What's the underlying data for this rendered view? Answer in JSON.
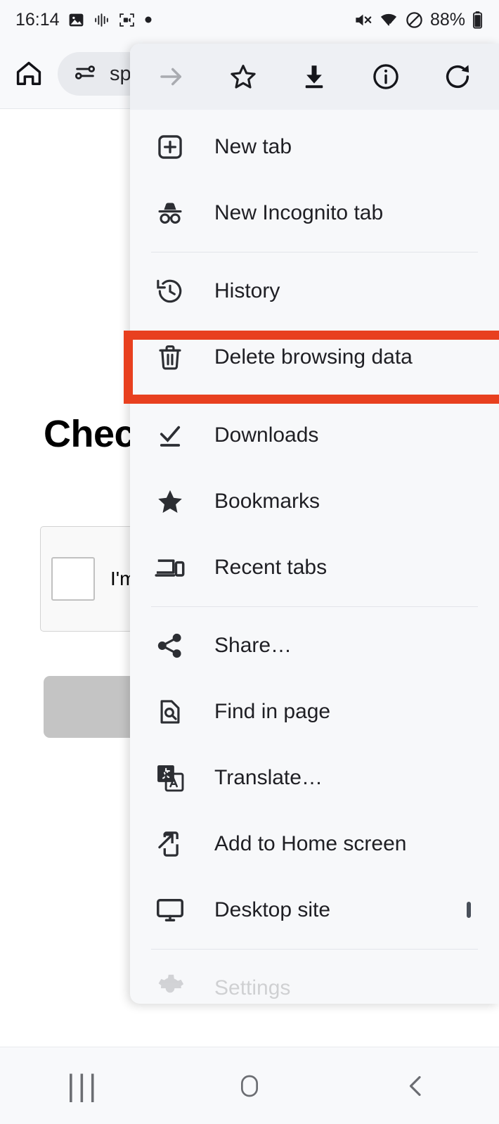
{
  "status_bar": {
    "clock": "16:14",
    "battery_percent": "88%",
    "left_icons": [
      "image-icon",
      "audio-waveform-icon",
      "screen-record-icon",
      "dot-indicator-icon"
    ],
    "right_icons": [
      "mute-icon",
      "wifi-icon",
      "do-not-disturb-icon",
      "battery-icon"
    ]
  },
  "browser_toolbar": {
    "home_icon": "home-icon",
    "url_icon": "page-settings-icon",
    "url_text": "sp"
  },
  "page": {
    "heading": "Chec",
    "captcha_label": "I'm",
    "button_label": ""
  },
  "menu": {
    "top_actions": [
      {
        "name": "forward-arrow-icon",
        "label": "Forward",
        "enabled": false
      },
      {
        "name": "star-icon",
        "label": "Bookmark",
        "enabled": true
      },
      {
        "name": "download-icon",
        "label": "Download page",
        "enabled": true
      },
      {
        "name": "info-icon",
        "label": "Page info",
        "enabled": true
      },
      {
        "name": "reload-icon",
        "label": "Reload",
        "enabled": true
      }
    ],
    "items": [
      {
        "label": "New tab",
        "icon": "new-tab-icon"
      },
      {
        "label": "New Incognito tab",
        "icon": "incognito-icon"
      },
      {
        "label": "History",
        "icon": "history-icon"
      },
      {
        "label": "Delete browsing data",
        "icon": "trash-icon"
      },
      {
        "label": "Downloads",
        "icon": "downloads-icon"
      },
      {
        "label": "Bookmarks",
        "icon": "star-filled-icon"
      },
      {
        "label": "Recent tabs",
        "icon": "recent-tabs-icon"
      },
      {
        "label": "Share…",
        "icon": "share-icon"
      },
      {
        "label": "Find in page",
        "icon": "find-in-page-icon"
      },
      {
        "label": "Translate…",
        "icon": "translate-icon"
      },
      {
        "label": "Add to Home screen",
        "icon": "add-to-home-icon"
      },
      {
        "label": "Desktop site",
        "icon": "desktop-site-icon",
        "trailing": "checkbox"
      },
      {
        "label": "Settings",
        "icon": "settings-gear-icon"
      }
    ]
  },
  "highlight": {
    "target_label": "Delete browsing data",
    "color": "#e8401f"
  },
  "nav_bar": {
    "recents_glyph": "|||",
    "home_label": "home-button",
    "back_label": "back-button"
  }
}
